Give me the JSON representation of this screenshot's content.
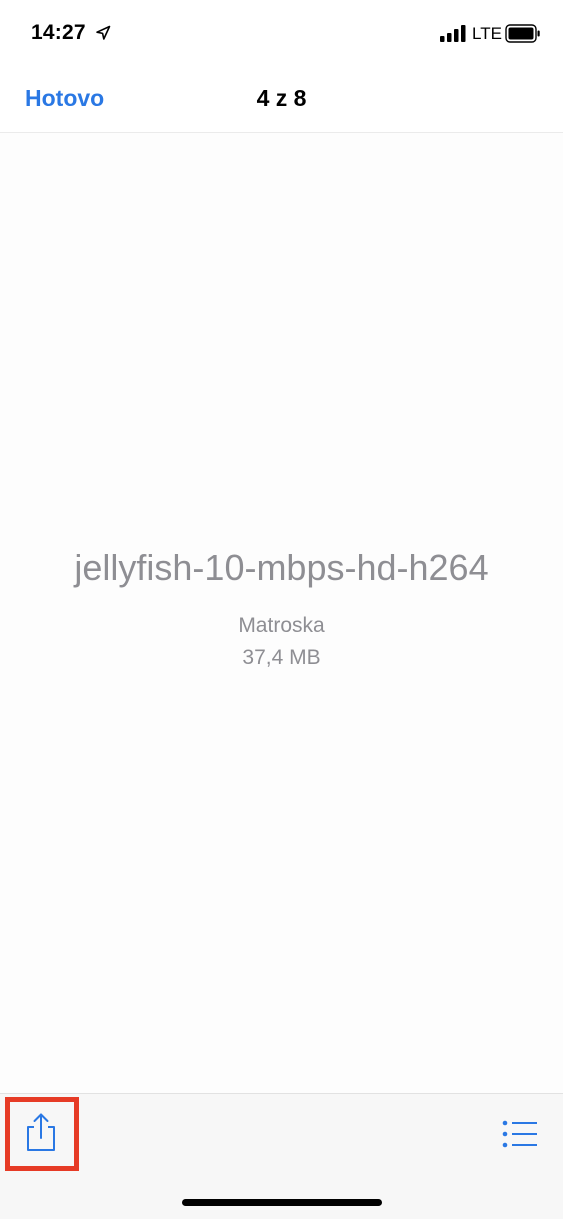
{
  "status_bar": {
    "time": "14:27",
    "network": "LTE",
    "icons": [
      "location-arrow-icon",
      "signal-bars-icon",
      "battery-icon"
    ]
  },
  "nav": {
    "done_label": "Hotovo",
    "title": "4 z 8"
  },
  "file": {
    "name": "jellyfish-10-mbps-hd-h264",
    "type": "Matroska",
    "size": "37,4 MB"
  },
  "toolbar": {
    "icons": [
      "share-icon",
      "list-icon"
    ]
  },
  "colors": {
    "accent": "#2a78e4",
    "highlight": "#e63b26",
    "secondary_text": "#8e8e93"
  }
}
